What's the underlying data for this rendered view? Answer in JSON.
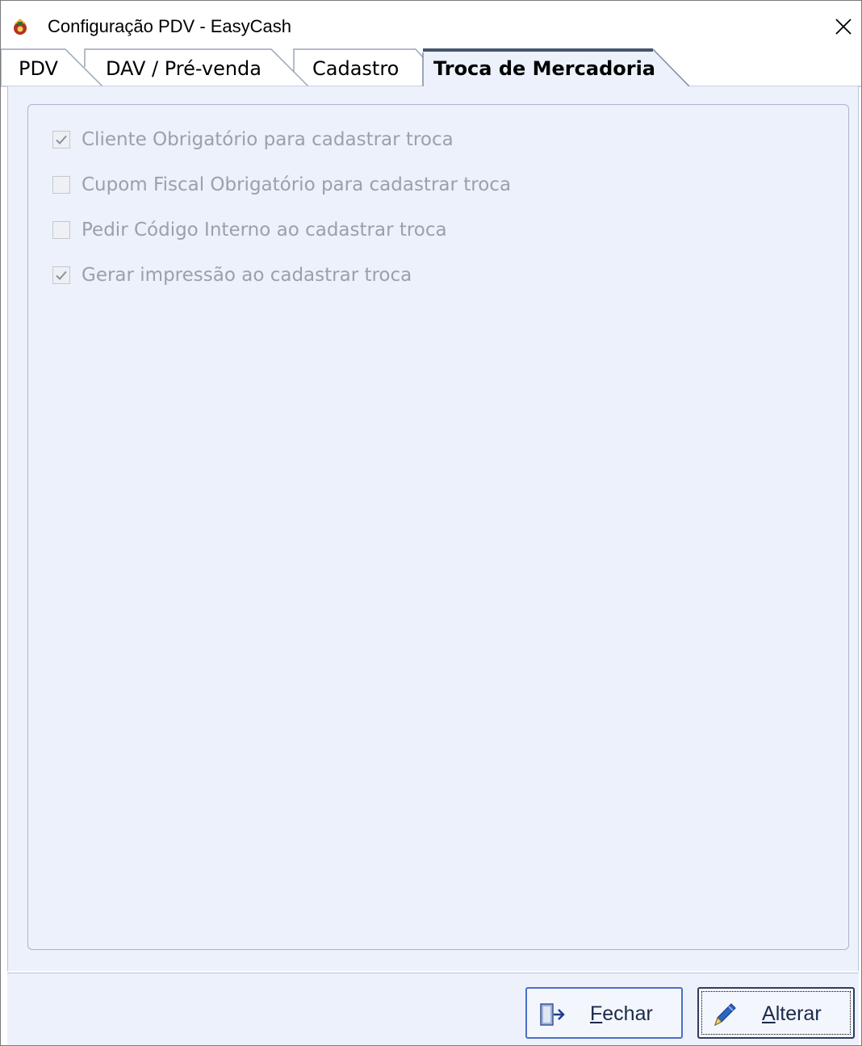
{
  "window": {
    "title": "Configuração PDV - EasyCash",
    "close_glyph": "✕"
  },
  "tabs": [
    {
      "label": "PDV",
      "active": false
    },
    {
      "label": "DAV / Pré-venda",
      "active": false
    },
    {
      "label": "Cadastro",
      "active": false
    },
    {
      "label": "Troca de Mercadoria",
      "active": true
    }
  ],
  "options": [
    {
      "label": "Cliente Obrigatório para cadastrar troca",
      "checked": true,
      "enabled": false
    },
    {
      "label": "Cupom Fiscal Obrigatório para cadastrar troca",
      "checked": false,
      "enabled": false
    },
    {
      "label": "Pedir Código Interno ao cadastrar troca",
      "checked": false,
      "enabled": false
    },
    {
      "label": "Gerar impressão ao cadastrar troca",
      "checked": true,
      "enabled": false
    }
  ],
  "buttons": {
    "close": {
      "mnemonic": "F",
      "rest": "echar",
      "icon": "exit-door-icon"
    },
    "edit": {
      "mnemonic": "A",
      "rest": "lterar",
      "icon": "pencil-icon",
      "focused": true
    }
  },
  "colors": {
    "accent": "#4a70c6",
    "panel_bg": "#ecf1fb",
    "disabled_text": "#9aa1ab"
  }
}
